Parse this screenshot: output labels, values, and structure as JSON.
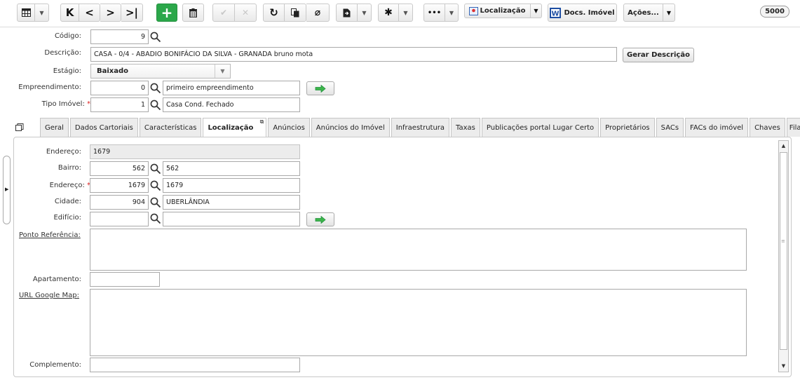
{
  "toolbar": {
    "localizacao_label": "Localização",
    "docs_label": "Docs. Imóvel",
    "acoes_label": "Ações...",
    "more_label": "•••",
    "count_badge": "5000"
  },
  "form": {
    "codigo": {
      "label": "Código:",
      "value": "9"
    },
    "descricao": {
      "label": "Descrição:",
      "value": "CASA - 0/4 - ABADIO BONIFÁCIO DA SILVA - GRANADA bruno mota"
    },
    "gerar_descricao_label": "Gerar Descrição",
    "estagio": {
      "label": "Estágio:",
      "value": "Baixado"
    },
    "empreendimento": {
      "label": "Empreendimento:",
      "code": "0",
      "name": "primeiro empreendimento"
    },
    "tipo_imovel": {
      "label": "Tipo Imóvel:",
      "required": "*",
      "code": "1",
      "name": "Casa Cond. Fechado"
    }
  },
  "tabs": [
    "Geral",
    "Dados Cartoriais",
    "Características",
    "Localização",
    "Anúncios",
    "Anúncios do Imóvel",
    "Infraestrutura",
    "Taxas",
    "Publicações portal Lugar Certo",
    "Proprietários",
    "SACs",
    "FACs do imóvel",
    "Chaves",
    "Fila"
  ],
  "localizacao": {
    "endereco_ro": {
      "label": "Endereço:",
      "value": "1679"
    },
    "bairro": {
      "label": "Bairro:",
      "code": "562",
      "name": "562"
    },
    "endereco": {
      "label": "Endereço:",
      "required": "*",
      "code": "1679",
      "name": "1679"
    },
    "cidade": {
      "label": "Cidade:",
      "code": "904",
      "name": "UBERLÂNDIA"
    },
    "edificio": {
      "label": "Edifício:",
      "code": "",
      "name": ""
    },
    "ponto_referencia_label": "Ponto Referência:",
    "apartamento_label": "Apartamento:",
    "url_google_map_label": "URL Google Map:",
    "complemento_label": "Complemento:"
  },
  "colors": {
    "accent_green": "#2ba74a",
    "required_red": "#d22222"
  }
}
